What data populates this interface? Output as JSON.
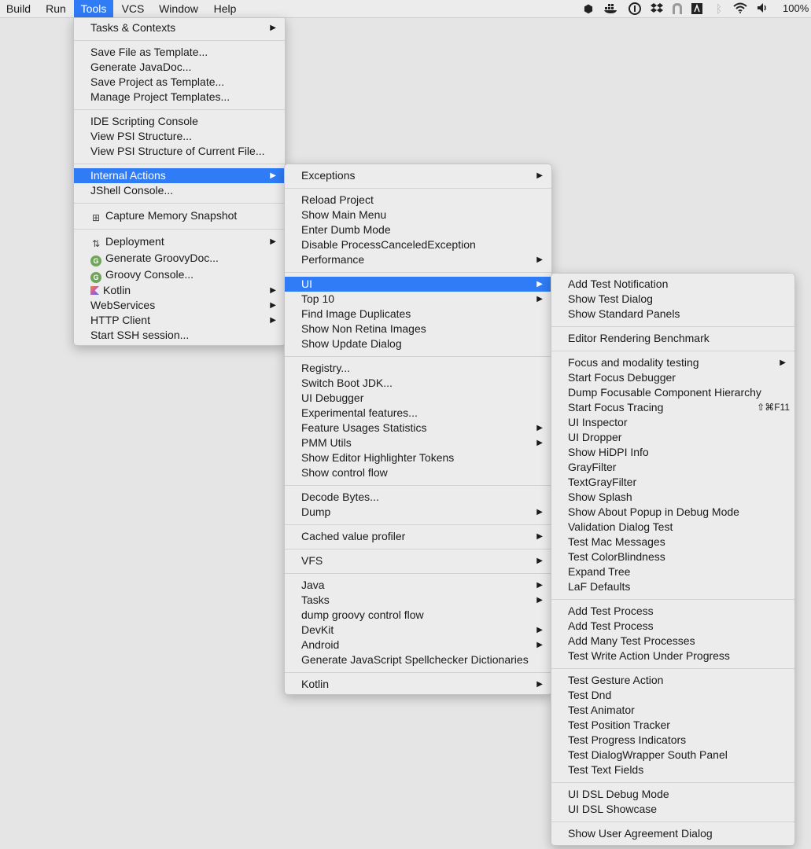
{
  "menubar": {
    "items": [
      "Build",
      "Run",
      "Tools",
      "VCS",
      "Window",
      "Help"
    ],
    "battery": "100%"
  },
  "tray_icons": [
    "package-icon",
    "docker-icon",
    "onepassword-icon",
    "dropbox-icon",
    "arch-icon",
    "text-icon",
    "bluetooth-icon",
    "wifi-icon",
    "volume-icon"
  ],
  "tools_menu": {
    "items": [
      "Tasks & Contexts",
      "Save File as Template...",
      "Generate JavaDoc...",
      "Save Project as Template...",
      "Manage Project Templates...",
      "IDE Scripting Console",
      "View PSI Structure...",
      "View PSI Structure of Current File...",
      "Internal Actions",
      "JShell Console...",
      "Capture Memory Snapshot",
      "Deployment",
      "Generate GroovyDoc...",
      "Groovy Console...",
      "Kotlin",
      "WebServices",
      "HTTP Client",
      "Start SSH session..."
    ]
  },
  "internal_menu": {
    "items": [
      "Exceptions",
      "Reload Project",
      "Show Main Menu",
      "Enter Dumb Mode",
      "Disable ProcessCanceledException",
      "Performance",
      "UI",
      "Top 10",
      "Find Image Duplicates",
      "Show Non Retina Images",
      "Show Update Dialog",
      "Registry...",
      "Switch Boot JDK...",
      "UI Debugger",
      "Experimental features...",
      "Feature Usages Statistics",
      "PMM Utils",
      "Show Editor Highlighter Tokens",
      "Show control flow",
      "Decode Bytes...",
      "Dump",
      "Cached value profiler",
      "VFS",
      "Java",
      "Tasks",
      "dump groovy control flow",
      "DevKit",
      "Android",
      "Generate JavaScript Spellchecker Dictionaries",
      "Kotlin"
    ]
  },
  "ui_menu": {
    "items": [
      "Add Test Notification",
      "Show Test Dialog",
      "Show Standard Panels",
      "Editor Rendering Benchmark",
      "Focus and modality testing",
      "Start Focus Debugger",
      "Dump Focusable Component Hierarchy",
      "Start Focus Tracing",
      "UI Inspector",
      "UI Dropper",
      "Show HiDPI Info",
      "GrayFilter",
      "TextGrayFilter",
      "Show Splash",
      "Show About Popup in Debug Mode",
      "Validation Dialog Test",
      "Test Mac Messages",
      "Test ColorBlindness",
      "Expand Tree",
      "LaF Defaults",
      "Add Test Process",
      "Add Test Process",
      "Add Many Test Processes",
      "Test Write Action Under Progress",
      "Test Gesture Action",
      "Test Dnd",
      "Test Animator",
      "Test Position Tracker",
      "Test Progress Indicators",
      "Test DialogWrapper South Panel",
      "Test Text Fields",
      "UI DSL Debug Mode",
      "UI DSL Showcase",
      "Show User Agreement Dialog"
    ],
    "focus_tracing_shortcut": "⇧⌘F11"
  }
}
